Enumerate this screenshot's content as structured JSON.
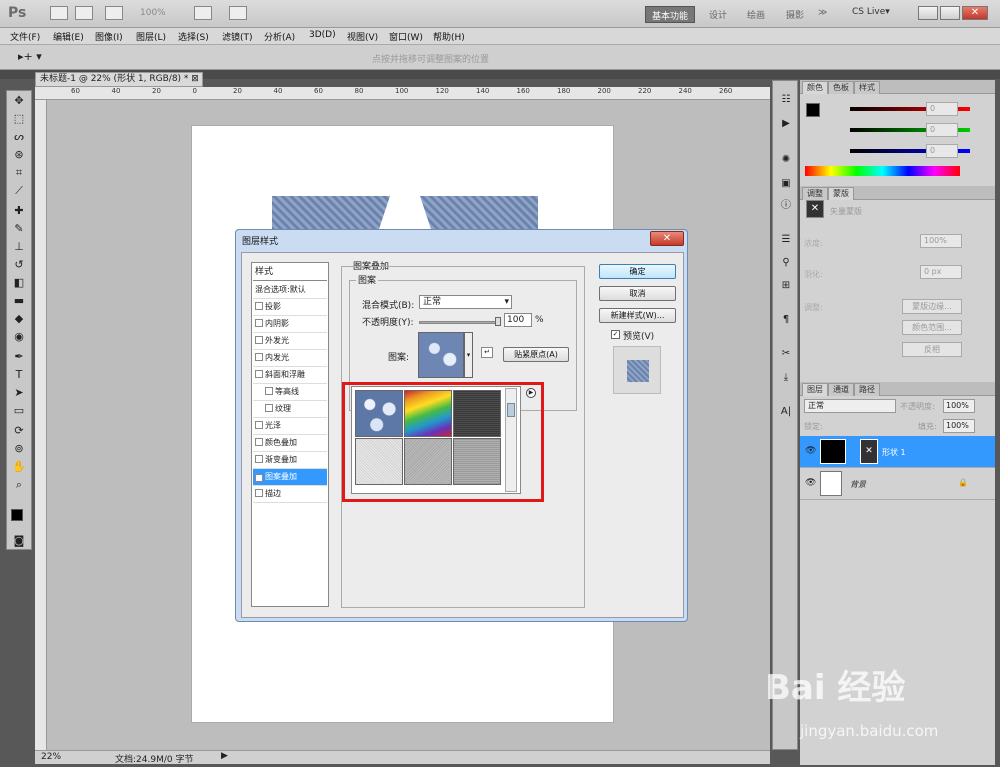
{
  "app": {
    "logo": "Ps",
    "zoom": "100%",
    "workspaces": [
      "基本功能",
      "设计",
      "绘画",
      "摄影"
    ],
    "more": "≫",
    "cslive": "CS Live▾"
  },
  "menu": [
    "文件(F)",
    "编辑(E)",
    "图像(I)",
    "图层(L)",
    "选择(S)",
    "滤镜(T)",
    "分析(A)",
    "3D(D)",
    "视图(V)",
    "窗口(W)",
    "帮助(H)"
  ],
  "options_bar": {
    "hint": "点按并拖移可调整图案的位置"
  },
  "document": {
    "tab": "未标题-1 @ 22% (形状 1, RGB/8) *",
    "zoom": "22%",
    "status": "文档:24.9M/0 字节"
  },
  "ruler_ticks": [
    "60",
    "40",
    "20",
    "0",
    "20",
    "40",
    "60",
    "80",
    "100",
    "120",
    "140",
    "160",
    "180",
    "200",
    "220",
    "240",
    "260"
  ],
  "color_panel": {
    "tabs": [
      "颜色",
      "色板",
      "样式"
    ],
    "r": "0",
    "g": "0",
    "b": "0"
  },
  "adjust_panel": {
    "tabs": [
      "调整",
      "蒙版"
    ],
    "title": "矢量蒙版",
    "density_label": "浓度:",
    "density": "100%",
    "feather_label": "羽化:",
    "feather": "0 px",
    "refine_label": "调整:",
    "buttons": [
      "蒙版边缘...",
      "颜色范围...",
      "反相"
    ]
  },
  "layers_panel": {
    "tabs": [
      "图层",
      "通道",
      "路径"
    ],
    "blend": "正常",
    "opacity_label": "不透明度:",
    "opacity": "100%",
    "lock_label": "锁定:",
    "fill_label": "填充:",
    "fill": "100%",
    "layers": [
      {
        "name": "形状 1"
      },
      {
        "name": "背景"
      }
    ]
  },
  "dialog": {
    "title": "图层样式",
    "styles_header": "样式",
    "items": [
      {
        "label": "混合选项:默认",
        "checkbox": false,
        "checked": false
      },
      {
        "label": "投影",
        "checkbox": true,
        "checked": false
      },
      {
        "label": "内阴影",
        "checkbox": true,
        "checked": false
      },
      {
        "label": "外发光",
        "checkbox": true,
        "checked": false
      },
      {
        "label": "内发光",
        "checkbox": true,
        "checked": false
      },
      {
        "label": "斜面和浮雕",
        "checkbox": true,
        "checked": false
      },
      {
        "label": "等高线",
        "checkbox": true,
        "checked": false
      },
      {
        "label": "纹理",
        "checkbox": true,
        "checked": false
      },
      {
        "label": "光泽",
        "checkbox": true,
        "checked": false
      },
      {
        "label": "颜色叠加",
        "checkbox": true,
        "checked": false
      },
      {
        "label": "渐变叠加",
        "checkbox": true,
        "checked": false
      },
      {
        "label": "图案叠加",
        "checkbox": true,
        "checked": true
      },
      {
        "label": "描边",
        "checkbox": true,
        "checked": false
      }
    ],
    "section_title": "图案叠加",
    "group_title": "图案",
    "blend_label": "混合模式(B):",
    "blend_value": "正常",
    "opacity_label": "不透明度(Y):",
    "opacity_value": "100",
    "opacity_unit": "%",
    "pattern_label": "图案:",
    "snap_button": "贴紧原点(A)",
    "ok": "确定",
    "cancel": "取消",
    "new_style": "新建样式(W)...",
    "preview": "预览(V)"
  },
  "watermark": {
    "brand": "Bai 经验",
    "url": "jingyan.baidu.com"
  }
}
